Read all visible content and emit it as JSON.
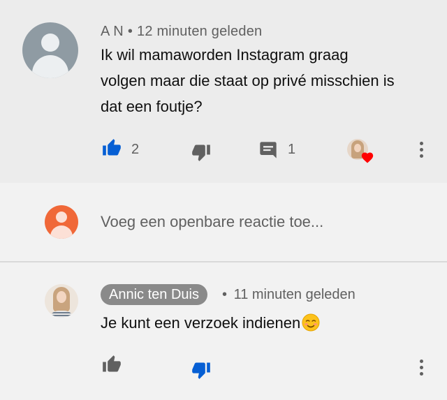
{
  "comment": {
    "author": "A N",
    "time": "12 minuten geleden",
    "text_lines": [
      "Ik wil mamaworden Instagram graag",
      "volgen maar die staat op privé misschien is",
      "dat een foutje?"
    ],
    "like_count": "2",
    "reply_count": "1",
    "liked": true,
    "creator_hearted": true
  },
  "add_comment": {
    "placeholder": "Voeg een openbare reactie toe..."
  },
  "reply": {
    "author": "Annic ten Duis",
    "time": "11 minuten geleden",
    "text": "Je kunt een verzoek indienen",
    "disliked": true
  },
  "separator": "•",
  "icons": {
    "like": "thumbs-up-icon",
    "dislike": "thumbs-down-icon",
    "reply": "comment-icon",
    "more": "more-vert-icon",
    "heart": "heart-icon",
    "emoji": "smiling-face-emoji"
  },
  "colors": {
    "active_blue": "#065fd4",
    "icon_gray": "#606060",
    "heart_red": "#ff0000",
    "own_avatar": "#f06838",
    "author_chip": "#8a8a8a"
  }
}
